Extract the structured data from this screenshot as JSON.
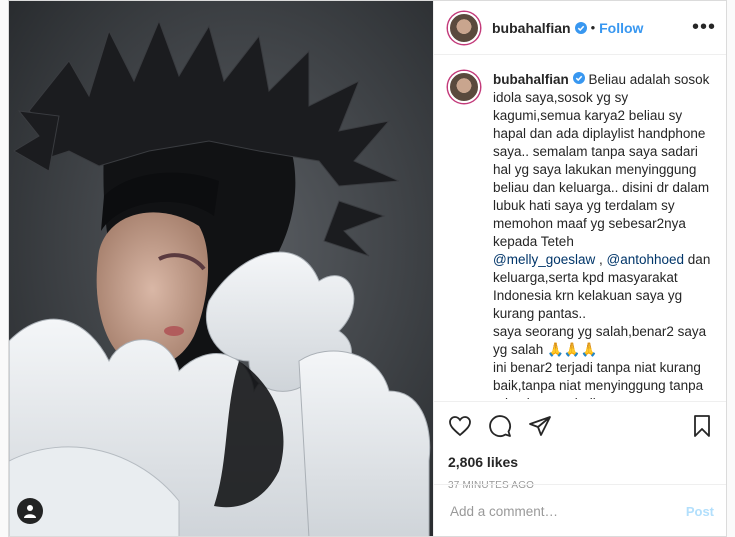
{
  "post": {
    "username": "bubahalfian",
    "follow_label": "Follow",
    "more_label": "•••",
    "dot": "•",
    "caption": {
      "username": "bubahalfian",
      "text_1": " Beliau adalah sosok idola saya,sosok yg sy kagumi,semua karya2 beliau sy hapal dan ada diplaylist handphone saya.. semalam tanpa saya sadari hal yg saya lakukan menyinggung beliau dan keluarga.. disini dr dalam lubuk hati saya yg terdalam sy memohon maaf yg sebesar2nya kepada Teteh\n",
      "mention_1": "@melly_goeslaw",
      "between": " , ",
      "mention_2": "@antohhoed",
      "text_2": " dan keluarga,serta kpd masyarakat Indonesia krn kelakuan saya yg kurang pantas..\nsaya seorang yg salah,benar2 saya yg salah 🙏🙏🙏\nini benar2 terjadi tanpa niat kurang baik,tanpa niat menyinggung tanpa ada niat membully..\nsaya berdandan seperti Teteh Melly Goeslaw krn beliau adalah Celebrity"
    },
    "likes": "2,806 likes",
    "time_ago": "37 MINUTES AGO",
    "comment_placeholder": "Add a comment…",
    "post_label": "Post"
  },
  "icons": {
    "verified": "verified-badge-icon",
    "like": "heart-icon",
    "comment": "comment-icon",
    "share": "share-icon",
    "save": "bookmark-icon",
    "user_tag": "user-tag-icon"
  },
  "colors": {
    "link": "#3897f0",
    "mention": "#003569",
    "post_disabled": "#b2dffc",
    "border": "#dbdbdb"
  }
}
